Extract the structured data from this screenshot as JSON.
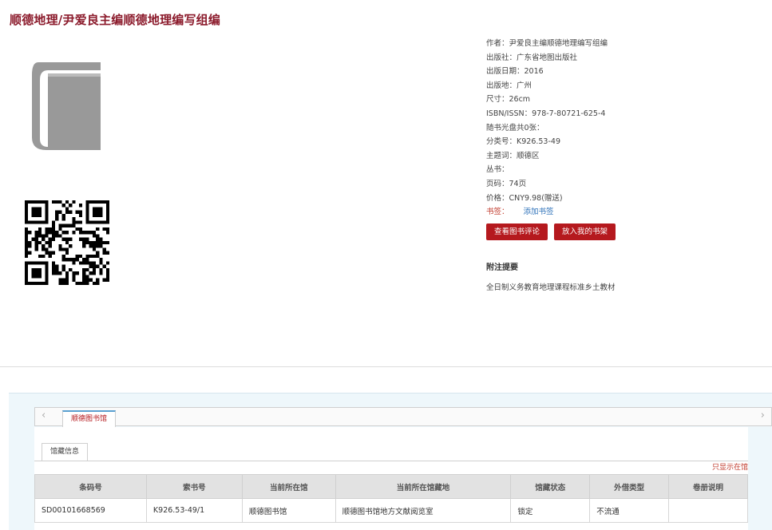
{
  "page": {
    "title": "顺德地理/尹爱良主编顺德地理编写组编"
  },
  "details": {
    "author": "作者：尹爱良主编顺德地理编写组编",
    "publisher": "出版社：广东省地图出版社",
    "pub_date": "出版日期：2016",
    "pub_place": "出版地：广州",
    "size": "尺寸：26cm",
    "isbn": "ISBN/ISSN：978-7-80721-625-4",
    "disc": "随书光盘共0张：",
    "class_no": "分类号：K926.53-49",
    "subject": "主题词：顺德区",
    "series": "丛书：",
    "pages": "页码：74页",
    "price": "价格：CNY9.98(赠送)",
    "tag_label": "书签：",
    "add_tag": "添加书签"
  },
  "actions": {
    "view_reviews": "查看图书评论",
    "add_shelf": "放入我的书架"
  },
  "notes": {
    "title": "附注提要",
    "body": "全日制义务教育地理课程标准乡土教材"
  },
  "holdings": {
    "library_tab": "顺德图书馆",
    "info_tab": "馆藏信息",
    "only_show": "只显示在馆",
    "columns": [
      "条码号",
      "索书号",
      "当前所在馆",
      "当前所在馆藏地",
      "馆藏状态",
      "外借类型",
      "卷册说明"
    ],
    "rows": [
      [
        "SD00101668569",
        "K926.53-49/1",
        "顺德图书馆",
        "顺德图书馆地方文献阅览室",
        "锁定",
        "不流通",
        ""
      ]
    ]
  },
  "colors": {
    "title": "#8b1a2b",
    "button": "#b5191e",
    "link": "#2a6fb8",
    "tab_accent": "#5aa0d0"
  }
}
